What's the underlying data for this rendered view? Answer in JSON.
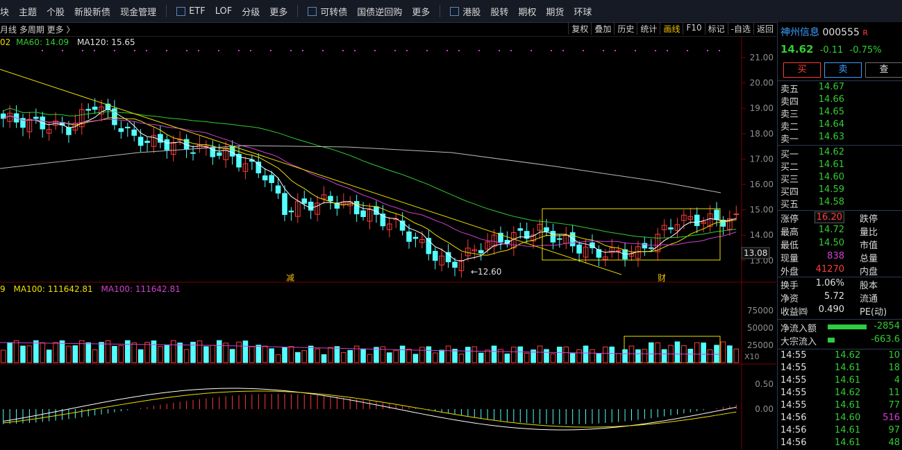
{
  "topbar": {
    "items": [
      "块",
      "主题",
      "个股",
      "新股新债",
      "现金管理"
    ],
    "items2": [
      "ETF",
      "LOF",
      "分级",
      "更多"
    ],
    "items3": [
      "可转债",
      "国债逆回购",
      "更多"
    ],
    "items4": [
      "港股",
      "股转",
      "期权",
      "期货",
      "环球"
    ]
  },
  "chart_toolbar": {
    "left": "月线  多周期  更多 〉",
    "buttons": [
      "复权",
      "叠加",
      "历史",
      "统计",
      "画线",
      "F10",
      "标记",
      "-自选",
      "返回"
    ],
    "active": "画线"
  },
  "ma_line": {
    "p1": "02",
    "p2": "MA60: 14.09",
    "p3": "MA120: 15.65"
  },
  "vol_line": {
    "p1": "9",
    "p2": "MA100: 111642.81",
    "p3": "MA100: 111642.81"
  },
  "price_axis": [
    "21.00",
    "20.00",
    "19.00",
    "18.00",
    "17.00",
    "16.00",
    "15.00",
    "14.00",
    "13.00"
  ],
  "price_marker": "13.08",
  "low_label": "12.60",
  "annot_jian": "减",
  "annot_cai": "财",
  "vol_axis": [
    "75000",
    "50000",
    "25000"
  ],
  "vol_unit": "X10",
  "macd_axis": [
    "0.50",
    "0.00"
  ],
  "stock": {
    "name": "神州信息",
    "code": "000555",
    "flag": "R",
    "price": "14.62",
    "change": "-0.11",
    "pct": "-0.75%"
  },
  "trade_buttons": [
    "买",
    "卖",
    "查"
  ],
  "asks": [
    {
      "label": "卖五",
      "price": "14.67"
    },
    {
      "label": "卖四",
      "price": "14.66"
    },
    {
      "label": "卖三",
      "price": "14.65"
    },
    {
      "label": "卖二",
      "price": "14.64"
    },
    {
      "label": "卖一",
      "price": "14.63"
    }
  ],
  "bids": [
    {
      "label": "买一",
      "price": "14.62"
    },
    {
      "label": "买二",
      "price": "14.61"
    },
    {
      "label": "买三",
      "price": "14.60"
    },
    {
      "label": "买四",
      "price": "14.59"
    },
    {
      "label": "买五",
      "price": "14.58"
    }
  ],
  "stats": [
    {
      "l": "涨停",
      "v": "16.20",
      "r": "跌停",
      "c": "#ff3b3b"
    },
    {
      "l": "最高",
      "v": "14.72",
      "r": "量比",
      "c": "#33cc33"
    },
    {
      "l": "最低",
      "v": "14.50",
      "r": "市值",
      "c": "#33cc33"
    },
    {
      "l": "现量",
      "v": "838",
      "r": "总量",
      "c": "#d040d0"
    },
    {
      "l": "外盘",
      "v": "41270",
      "r": "内盘",
      "c": "#ff3b3b"
    }
  ],
  "stats2": [
    {
      "l": "换手",
      "v": "1.06%",
      "r": "股本"
    },
    {
      "l": "净资",
      "v": "5.72",
      "r": "流通"
    },
    {
      "l": "收益㈣",
      "v": "0.490",
      "r": "PE(动)"
    }
  ],
  "flows": [
    {
      "l": "净流入额",
      "v": "-2854"
    },
    {
      "l": "大宗流入",
      "v": "-663.6"
    }
  ],
  "ticks": [
    {
      "t": "14:55",
      "p": "14.62",
      "v": "10"
    },
    {
      "t": "14:55",
      "p": "14.61",
      "v": "18"
    },
    {
      "t": "14:55",
      "p": "14.61",
      "v": "4"
    },
    {
      "t": "14:55",
      "p": "14.62",
      "v": "11"
    },
    {
      "t": "14:55",
      "p": "14.61",
      "v": "77"
    },
    {
      "t": "14:56",
      "p": "14.60",
      "v": "516"
    },
    {
      "t": "14:56",
      "p": "14.61",
      "v": "97"
    },
    {
      "t": "14:56",
      "p": "14.61",
      "v": "48"
    }
  ],
  "colors": {
    "up": "#ff3b3b",
    "down": "#54ffff",
    "green": "#33cc33",
    "yellow": "#f0e000",
    "magenta": "#d040d0"
  }
}
